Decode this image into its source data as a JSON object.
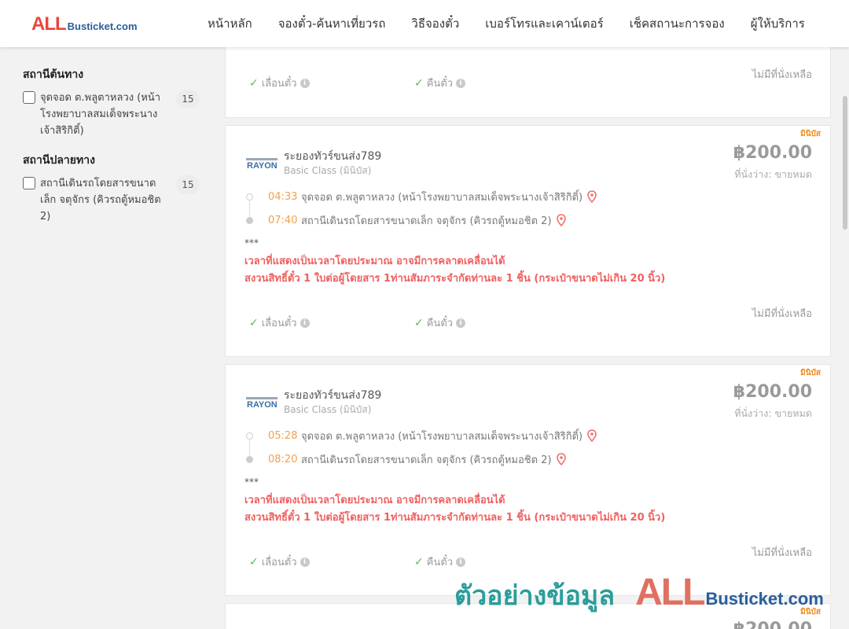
{
  "header": {
    "logo_all": "ALL",
    "logo_rest": "Busticket.com",
    "nav": [
      "หน้าหลัก",
      "จองตั๋ว-ค้นหาเที่ยวรถ",
      "วิธีจองตั๋ว",
      "เบอร์โทรและเคาน์เตอร์",
      "เช็คสถานะการจอง",
      "ผู้ให้บริการ"
    ]
  },
  "sidebar": {
    "origin_title": "สถานีต้นทาง",
    "origin_items": [
      {
        "label": "จุดจอด ต.พลูตาหลวง (หน้าโรงพยาบาลสมเด็จพระนางเจ้าสิริกิติ์)",
        "count": "15"
      }
    ],
    "dest_title": "สถานีปลายทาง",
    "dest_items": [
      {
        "label": "สถานีเดินรถโดยสารขนาดเล็ก จตุจักร (คิวรถตู้หมอชิต 2)",
        "count": "15"
      }
    ]
  },
  "common": {
    "reschedule": "เลื่อนตั๋ว",
    "refund": "คืนตั๋ว",
    "no_seat": "ไม่มีที่นั่งเหลือ",
    "mini_tag": "มินิบัส",
    "stars": "***",
    "warning_1": "เวลาที่แสดงเป็นเวลาโดยประมาณ อาจมีการคลาดเคลื่อนได้",
    "warning_2": "สงวนสิทธิ์ตั๋ว 1 ใบต่อผู้โดยสาร 1ท่านสัมภาระจำกัดท่านละ 1 ชิ้น (กระเป๋าขนาดไม่เกิน 20 นิ้ว)"
  },
  "trips": [
    {
      "operator": "ระยองทัวร์ขนส่ง789",
      "class": "Basic Class (มินิบัส)",
      "price": "฿200.00",
      "seats": "ที่นั่งว่าง: ขายหมด",
      "dep_time": "04:33",
      "dep_stop": "จุดจอด ต.พลูตาหลวง (หน้าโรงพยาบาลสมเด็จพระนางเจ้าสิริกิติ์)",
      "arr_time": "07:40",
      "arr_stop": "สถานีเดินรถโดยสารขนาดเล็ก จตุจักร (คิวรถตู้หมอชิต 2)"
    },
    {
      "operator": "ระยองทัวร์ขนส่ง789",
      "class": "Basic Class (มินิบัส)",
      "price": "฿200.00",
      "seats": "ที่นั่งว่าง: ขายหมด",
      "dep_time": "05:28",
      "dep_stop": "จุดจอด ต.พลูตาหลวง (หน้าโรงพยาบาลสมเด็จพระนางเจ้าสิริกิติ์)",
      "arr_time": "08:20",
      "arr_stop": "สถานีเดินรถโดยสารขนาดเล็ก จตุจักร (คิวรถตู้หมอชิต 2)"
    }
  ],
  "partial_card": {
    "mini_tag": "มินิบัส",
    "price": "฿200.00"
  },
  "watermark": {
    "text": "ตัวอย่างข้อมูล",
    "all": "ALL",
    "rest": "Busticket.com"
  },
  "colors": {
    "brand_red": "#e8463c",
    "brand_blue": "#2a5e9c",
    "time_orange": "#f0a050",
    "warning_red": "#f06060",
    "check_green": "#5cb85c"
  }
}
